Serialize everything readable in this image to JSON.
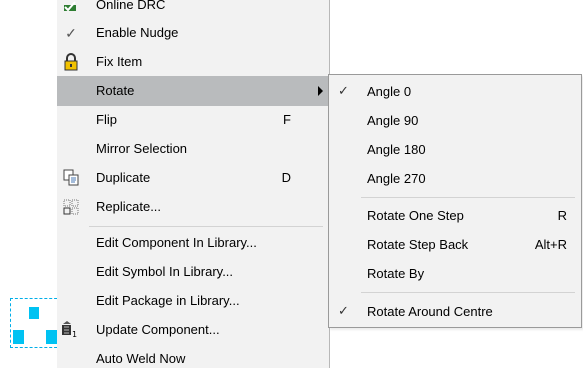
{
  "menu": {
    "items": [
      {
        "label": "Online DRC",
        "shortcut": "",
        "icon": "online-drc-icon"
      },
      {
        "label": "Enable Nudge",
        "shortcut": "",
        "icon": "check-icon"
      },
      {
        "label": "Fix Item",
        "shortcut": "",
        "icon": "lock-icon"
      },
      {
        "label": "Rotate",
        "shortcut": "",
        "icon": "submenu-arrow-icon"
      },
      {
        "label": "Flip",
        "shortcut": "F",
        "icon": ""
      },
      {
        "label": "Mirror Selection",
        "shortcut": "",
        "icon": ""
      },
      {
        "label": "Duplicate",
        "shortcut": "D",
        "icon": "duplicate-icon"
      },
      {
        "label": "Replicate...",
        "shortcut": "",
        "icon": "replicate-icon"
      },
      {
        "label": "Edit Component In Library...",
        "shortcut": "",
        "icon": ""
      },
      {
        "label": "Edit Symbol In Library...",
        "shortcut": "",
        "icon": ""
      },
      {
        "label": "Edit Package in Library...",
        "shortcut": "",
        "icon": ""
      },
      {
        "label": "Update Component...",
        "shortcut": "",
        "icon": "update-component-icon"
      },
      {
        "label": "Auto Weld Now",
        "shortcut": "",
        "icon": ""
      }
    ]
  },
  "submenu": {
    "items": [
      {
        "label": "Angle 0",
        "shortcut": "",
        "checked": true
      },
      {
        "label": "Angle 90",
        "shortcut": "",
        "checked": false
      },
      {
        "label": "Angle 180",
        "shortcut": "",
        "checked": false
      },
      {
        "label": "Angle 270",
        "shortcut": "",
        "checked": false
      },
      {
        "label": "Rotate One Step",
        "shortcut": "R",
        "checked": false
      },
      {
        "label": "Rotate Step Back",
        "shortcut": "Alt+R",
        "checked": false
      },
      {
        "label": "Rotate By",
        "shortcut": "",
        "checked": false
      },
      {
        "label": "Rotate Around Centre",
        "shortcut": "",
        "checked": true
      }
    ]
  },
  "colors": {
    "menu_bg": "#f2f2f2",
    "highlight": "#b9bbbd",
    "pad": "#00c2f2"
  }
}
